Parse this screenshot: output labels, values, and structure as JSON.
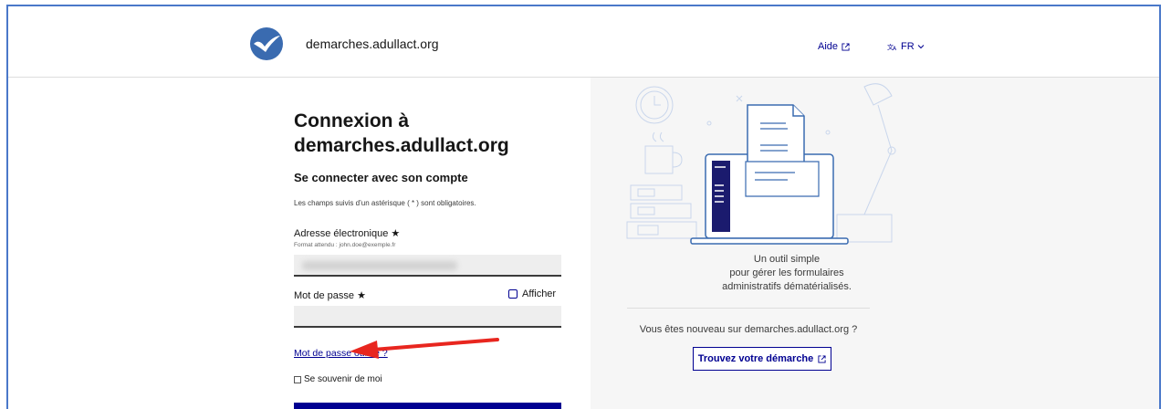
{
  "header": {
    "site_name": "demarches.adullact.org",
    "help_label": "Aide",
    "language_label": "FR"
  },
  "login": {
    "title_line1": "Connexion à",
    "title_line2": "demarches.adullact.org",
    "subtitle": "Se connecter avec son compte",
    "required_note": "Les champs suivis d’un astérisque ( * ) sont obligatoires.",
    "email_label": "Adresse électronique ★",
    "email_hint": "Format attendu : john.doe@exemple.fr",
    "password_label": "Mot de passe ★",
    "show_password_label": "Afficher",
    "forgot_password_label": "Mot de passe oublié ?",
    "remember_me_label": "Se souvenir de moi"
  },
  "promo": {
    "tagline_line1": "Un outil simple",
    "tagline_line2": "pour gérer les formulaires",
    "tagline_line3": "administratifs dématérialisés.",
    "new_user_text": "Vous êtes nouveau sur demarches.adullact.org ?",
    "find_button_label": "Trouvez votre démarche"
  },
  "colors": {
    "primary": "#000091",
    "frame_border": "#4a78c9",
    "annotation_arrow": "#e8261f",
    "panel_bg": "#f6f6f6"
  },
  "icons": {
    "logo": "check-circle-logo",
    "external": "external-link-icon",
    "language": "translate-icon",
    "chevron": "chevron-down-icon"
  }
}
